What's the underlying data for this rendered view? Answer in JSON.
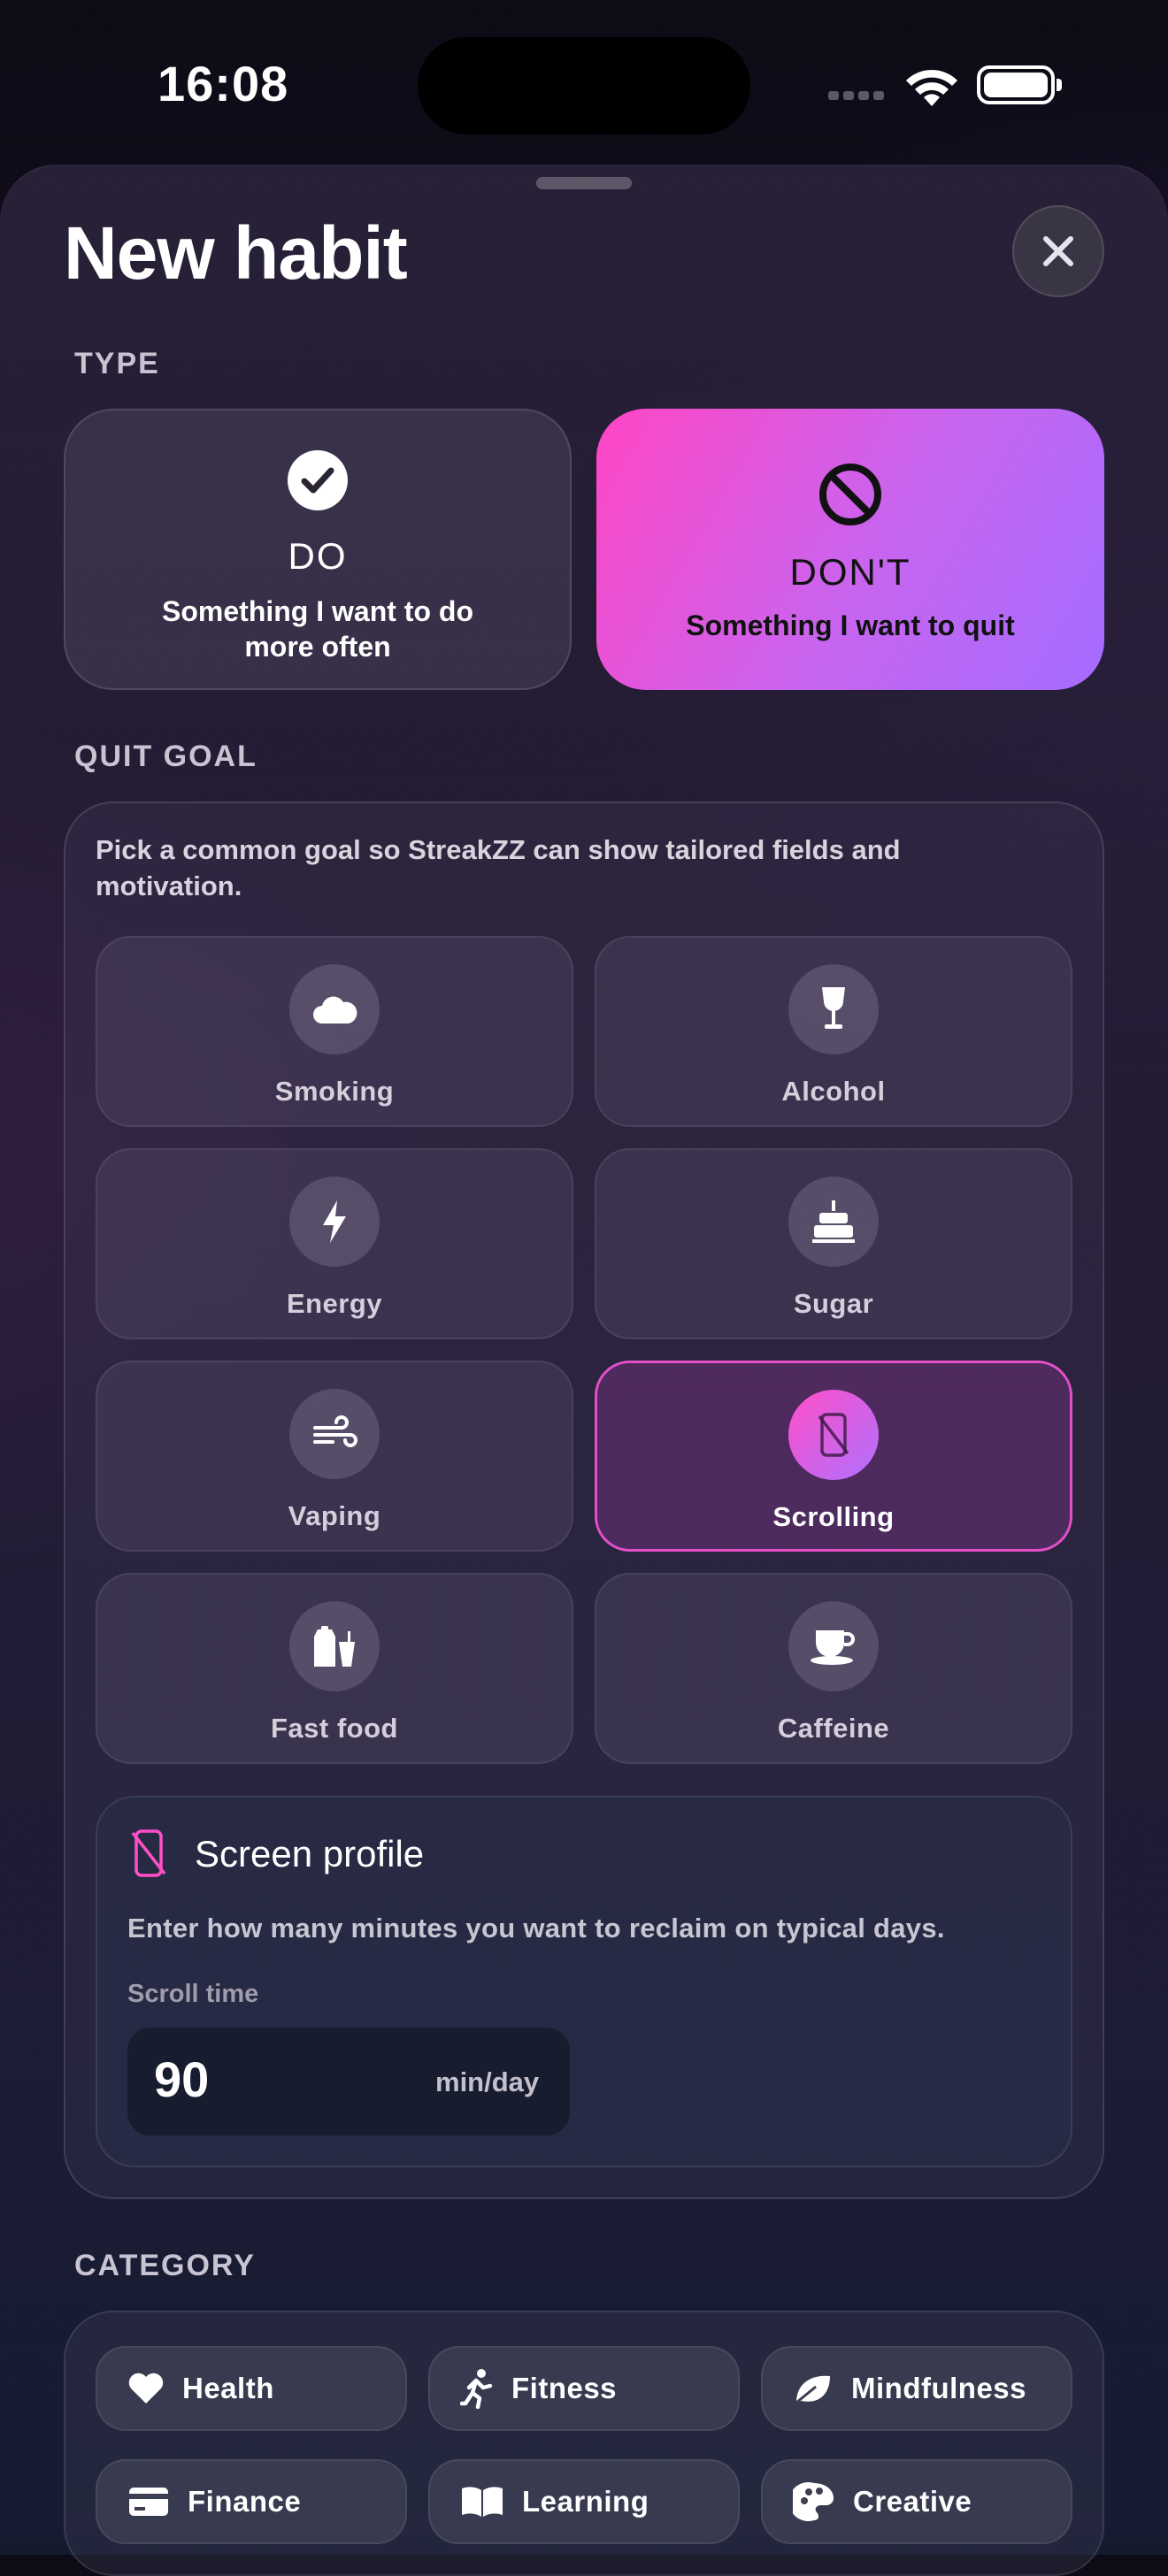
{
  "status": {
    "time": "16:08"
  },
  "header": {
    "title": "New habit"
  },
  "type_section": {
    "label": "TYPE",
    "options": [
      {
        "title": "DO",
        "subtitle": "Something I want to do more often",
        "selected": false,
        "icon": "checkmark-circle-icon"
      },
      {
        "title": "DON'T",
        "subtitle": "Something I want to quit",
        "selected": true,
        "icon": "prohibited-icon"
      }
    ]
  },
  "quit_goal": {
    "label": "QUIT GOAL",
    "description": "Pick a common goal so StreakZZ can show tailored fields and motivation.",
    "options": [
      {
        "label": "Smoking",
        "icon": "smoke-cloud-icon"
      },
      {
        "label": "Alcohol",
        "icon": "wine-glass-icon"
      },
      {
        "label": "Energy",
        "icon": "lightning-bolt-icon"
      },
      {
        "label": "Sugar",
        "icon": "birthday-cake-icon"
      },
      {
        "label": "Vaping",
        "icon": "wind-icon"
      },
      {
        "label": "Scrolling",
        "icon": "phone-slash-icon",
        "selected": true
      },
      {
        "label": "Fast food",
        "icon": "takeout-icon"
      },
      {
        "label": "Caffeine",
        "icon": "coffee-cup-icon"
      }
    ]
  },
  "screen_profile": {
    "title": "Screen profile",
    "description": "Enter how many minutes you want to reclaim on typical days.",
    "field_label": "Scroll time",
    "value": "90",
    "unit": "min/day"
  },
  "category": {
    "label": "CATEGORY",
    "options": [
      {
        "label": "Health",
        "icon": "heart-icon"
      },
      {
        "label": "Fitness",
        "icon": "runner-icon"
      },
      {
        "label": "Mindfulness",
        "icon": "leaf-icon"
      },
      {
        "label": "Finance",
        "icon": "credit-card-icon"
      },
      {
        "label": "Learning",
        "icon": "book-icon"
      },
      {
        "label": "Creative",
        "icon": "palette-icon"
      }
    ]
  },
  "colors": {
    "accent_pink": "#ff46c4",
    "accent_purple": "#a46cff"
  }
}
